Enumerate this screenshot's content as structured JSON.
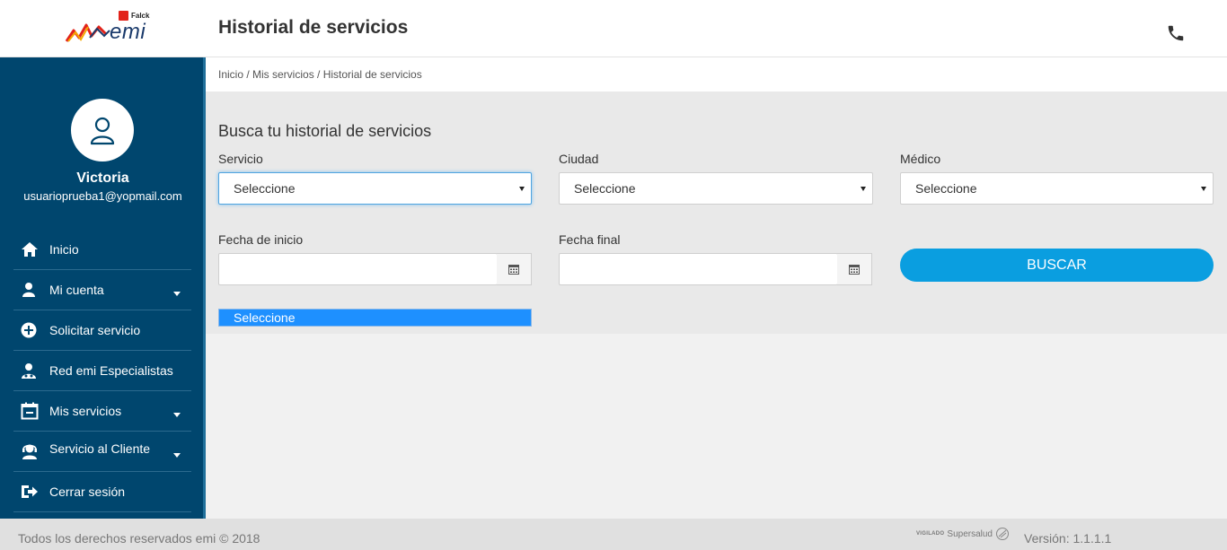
{
  "brand": {
    "falck_label": "Falck",
    "emi_label": "emi"
  },
  "header": {
    "title": "Historial de servicios",
    "phone_icon": "phone-icon"
  },
  "user": {
    "name": "Victoria",
    "email": "usuarioprueba1@yopmail.com",
    "avatar_icon": "user-icon"
  },
  "sidebar": {
    "items": [
      {
        "label": "Inicio",
        "icon": "home-icon",
        "has_submenu": false
      },
      {
        "label": "Mi cuenta",
        "icon": "user-icon",
        "has_submenu": true
      },
      {
        "label": "Solicitar servicio",
        "icon": "plus-circle-icon",
        "has_submenu": false
      },
      {
        "label": "Red emi Especialistas",
        "icon": "doctor-icon",
        "has_submenu": false
      },
      {
        "label": "Mis servicios",
        "icon": "calendar-icon",
        "has_submenu": true
      },
      {
        "label": "Servicio al Cliente",
        "icon": "headset-icon",
        "has_submenu": true
      },
      {
        "label": "Cerrar sesión",
        "icon": "logout-icon",
        "has_submenu": false
      }
    ]
  },
  "breadcrumb": "Inicio / Mis servicios / Historial de servicios",
  "search": {
    "title": "Busca tu historial de servicios",
    "servicio": {
      "label": "Servicio",
      "value": "Seleccione"
    },
    "ciudad": {
      "label": "Ciudad",
      "value": "Seleccione"
    },
    "medico": {
      "label": "Médico",
      "value": "Seleccione"
    },
    "fecha_inicio": {
      "label": "Fecha de inicio",
      "value": ""
    },
    "fecha_final": {
      "label": "Fecha final",
      "value": ""
    },
    "buscar_label": "BUSCAR",
    "dropdown_option": "Seleccione"
  },
  "footer": {
    "copyright": "Todos los derechos reservados emi © 2018",
    "vigilado_small": "VIGILADO",
    "vigilado_big": "Supersalud",
    "version": "Versión: 1.1.1.1"
  },
  "colors": {
    "sidebar": "#00466e",
    "accent": "#0a9ee0",
    "dropdown_highlight": "#1e90ff"
  }
}
